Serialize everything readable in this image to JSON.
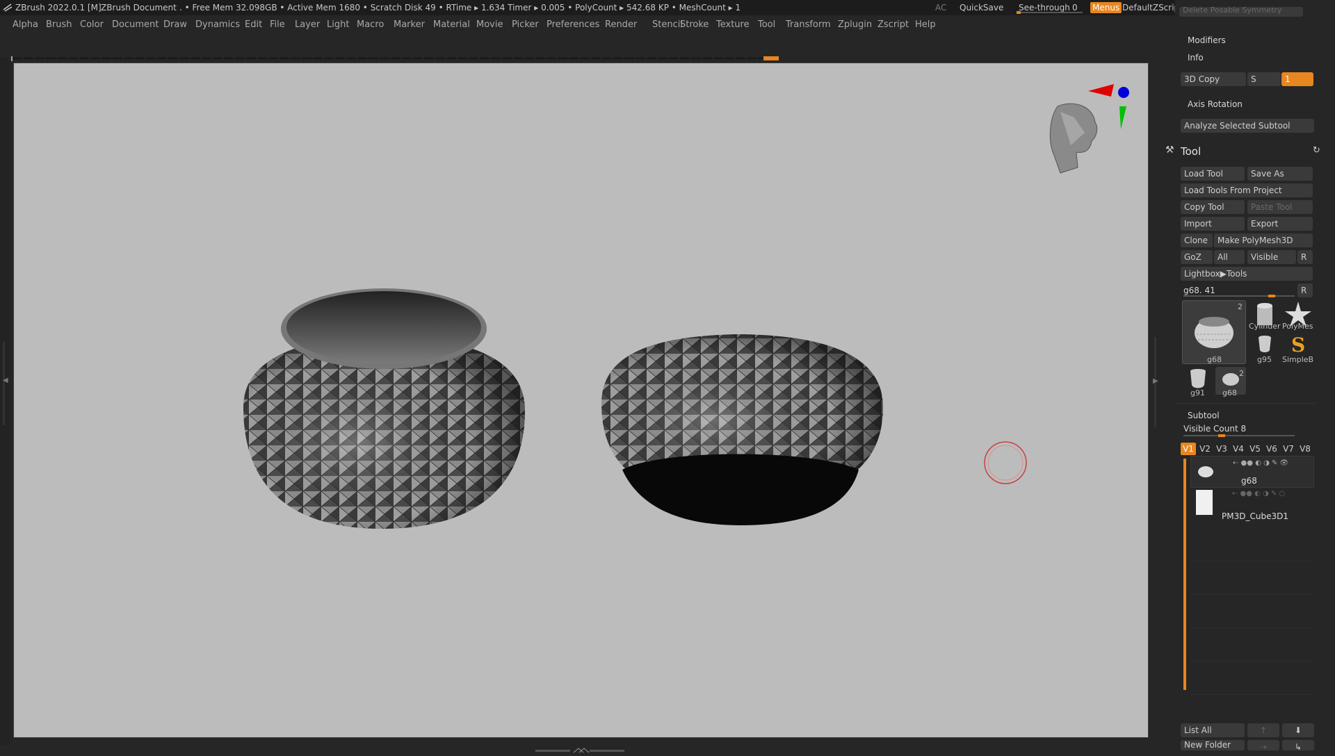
{
  "titlebar": {
    "app_title": "ZBrush 2022.0.1 [M]",
    "document": "ZBrush Document",
    "stats": ". • Free Mem 32.098GB • Active Mem 1680 • Scratch Disk 49 •  RTime ▸ 1.634 Timer ▸ 0.005 • PolyCount ▸ 542.68 KP  • MeshCount ▸ 1",
    "ac": "AC",
    "quicksave": "QuickSave",
    "see_through_label": "See-through",
    "see_through_value": "0",
    "menus": "Menus",
    "default_zscript": "DefaultZScript"
  },
  "menubar": [
    "Alpha",
    "Brush",
    "Color",
    "Document",
    "Draw",
    "Dynamics",
    "Edit",
    "File",
    "Layer",
    "Light",
    "Macro",
    "Marker",
    "Material",
    "Movie",
    "Picker",
    "Preferences",
    "Render",
    "Stencil",
    "Stroke",
    "Texture",
    "Tool",
    "Transform",
    "Zplugin",
    "Zscript",
    "Help"
  ],
  "panel": {
    "top_cut": "Delete Posable Symmetry",
    "modifiers": "Modifiers",
    "info": "Info",
    "copy3d": "3D Copy",
    "s_label": "S",
    "s_value": "1",
    "axis_rotation": "Axis Rotation",
    "analyze": "Analyze Selected Subtool",
    "tool_title": "Tool",
    "load_tool": "Load Tool",
    "save_as": "Save As",
    "load_from_project": "Load Tools From Project",
    "copy_tool": "Copy Tool",
    "paste_tool": "Paste Tool",
    "import": "Import",
    "export": "Export",
    "clone": "Clone",
    "make_polymesh": "Make PolyMesh3D",
    "goz": "GoZ",
    "all": "All",
    "visible": "Visible",
    "r": "R",
    "lightbox_tools": "Lightbox▶Tools",
    "current_tool": "g68. 41",
    "current_tool_r": "R",
    "thumbs": {
      "main_name": "g68",
      "main_count": "2",
      "cyl": "Cylinder",
      "poly": "PolyMes",
      "g95": "g95",
      "simple": "SimpleB",
      "g91": "g91",
      "g68b": "g68",
      "g68b_count": "2"
    },
    "subtool_title": "Subtool",
    "visible_count": "Visible Count 8",
    "vtabs": [
      "V1",
      "V2",
      "V3",
      "V4",
      "V5",
      "V6",
      "V7",
      "V8"
    ],
    "subtool1": "g68",
    "subtool2": "PM3D_Cube3D1",
    "list_all": "List All",
    "new_folder": "New Folder"
  },
  "colors": {
    "accent": "#e8861f",
    "menus_bg": "#e8861f",
    "viewport_bg": "#bcbcbc"
  }
}
